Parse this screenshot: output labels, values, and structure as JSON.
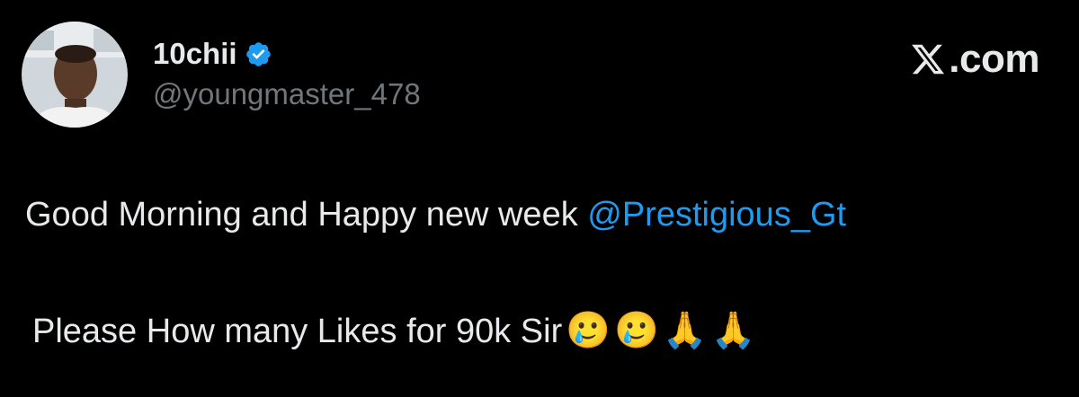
{
  "author": {
    "display_name": "10chii",
    "handle": "@youngmaster_478",
    "verified": true,
    "verified_icon": "verified-badge-icon",
    "avatar_icon": "profile-photo"
  },
  "brand": {
    "logo_icon": "x-logo-icon",
    "text": ".com"
  },
  "tweet": {
    "line1_text": "Good Morning and Happy new week ",
    "mention": "@Prestigious_Gt",
    "line2_text": "Please How many Likes for 90k Sir",
    "emojis": [
      "🥲",
      "🥲",
      "🙏",
      "🙏"
    ]
  },
  "colors": {
    "background": "#000000",
    "text": "#e7e9ea",
    "secondary": "#71767b",
    "accent": "#1d9bf0"
  }
}
